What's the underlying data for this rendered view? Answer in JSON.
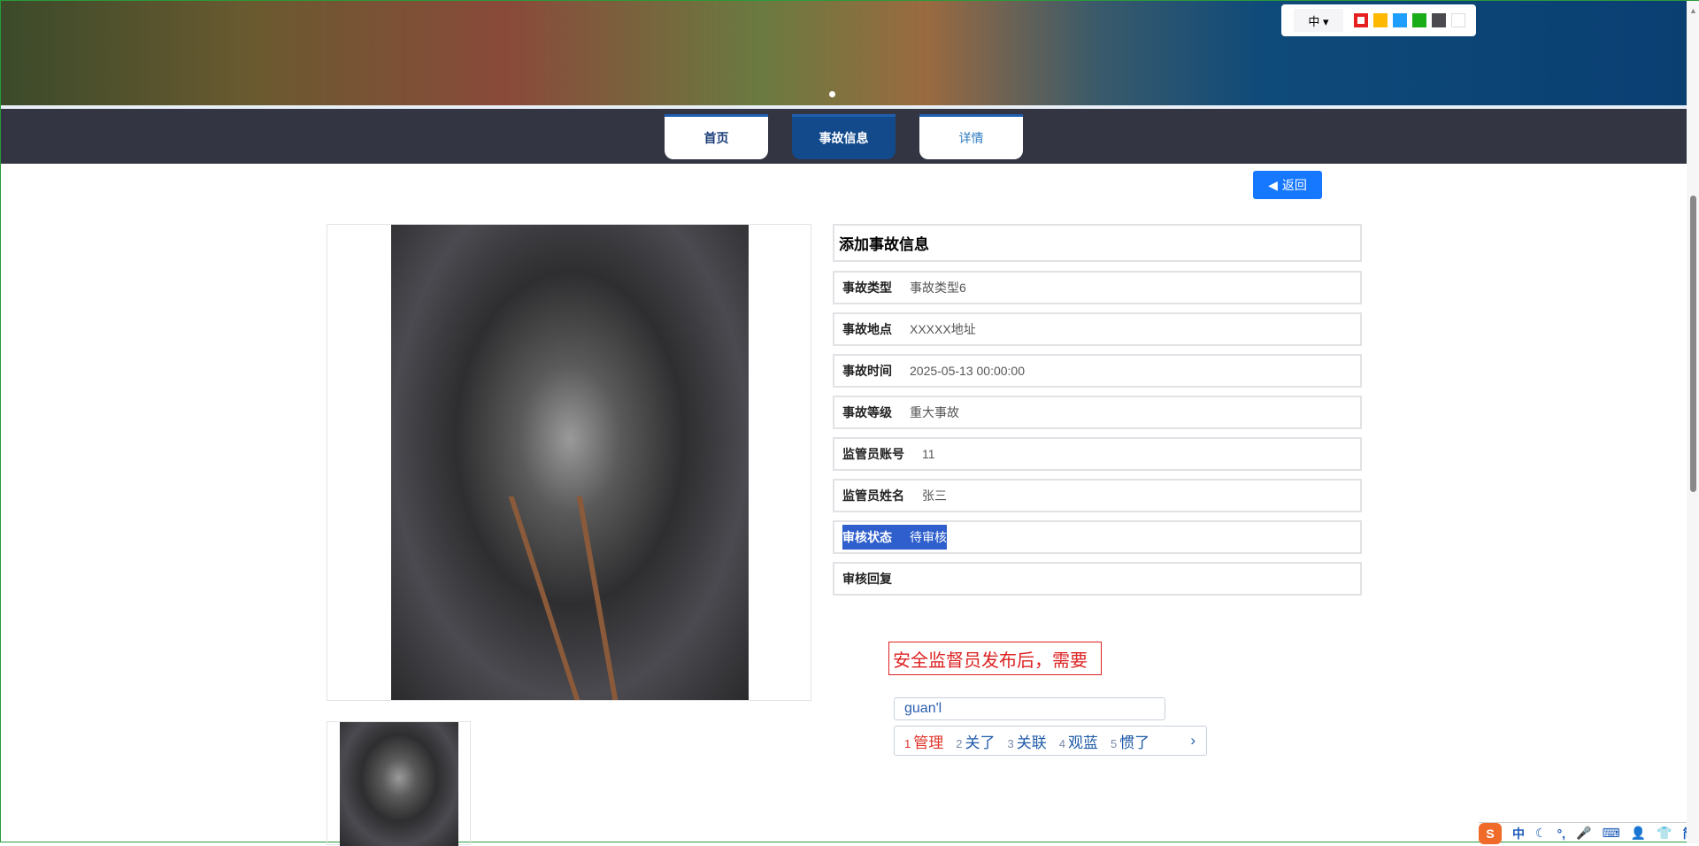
{
  "toolbar": {
    "size_label": "中 ▾",
    "swatches": [
      "#e62020",
      "#ffb800",
      "#1e9fff",
      "#1aad19",
      "#4b4b4f",
      "#ffffff"
    ]
  },
  "nav": {
    "tabs": [
      {
        "label": "首页"
      },
      {
        "label": "事故信息"
      },
      {
        "label": "详情"
      }
    ]
  },
  "back_label": "返回",
  "panel": {
    "title": "添加事故信息",
    "rows": [
      {
        "key": "事故类型",
        "value": "事故类型6"
      },
      {
        "key": "事故地点",
        "value": "XXXXX地址"
      },
      {
        "key": "事故时间",
        "value": "2025-05-13 00:00:00"
      },
      {
        "key": "事故等级",
        "value": "重大事故"
      },
      {
        "key": "监管员账号",
        "value": "11"
      },
      {
        "key": "监管员姓名",
        "value": "张三"
      },
      {
        "key": "审核状态",
        "value": "待审核"
      },
      {
        "key": "审核回复",
        "value": ""
      }
    ]
  },
  "editing_text": "安全监督员发布后，需要",
  "ime": {
    "input": "guan'l",
    "candidates": [
      {
        "n": "1",
        "t": "管理"
      },
      {
        "n": "2",
        "t": "关了"
      },
      {
        "n": "3",
        "t": "关联"
      },
      {
        "n": "4",
        "t": "观蓝"
      },
      {
        "n": "5",
        "t": "惯了"
      }
    ],
    "more": "›"
  },
  "statusbar": {
    "logo": "S",
    "items": [
      "中",
      "☾",
      "°,",
      "🎤",
      "⌨",
      "👤",
      "👕",
      "简",
      "▦"
    ]
  }
}
